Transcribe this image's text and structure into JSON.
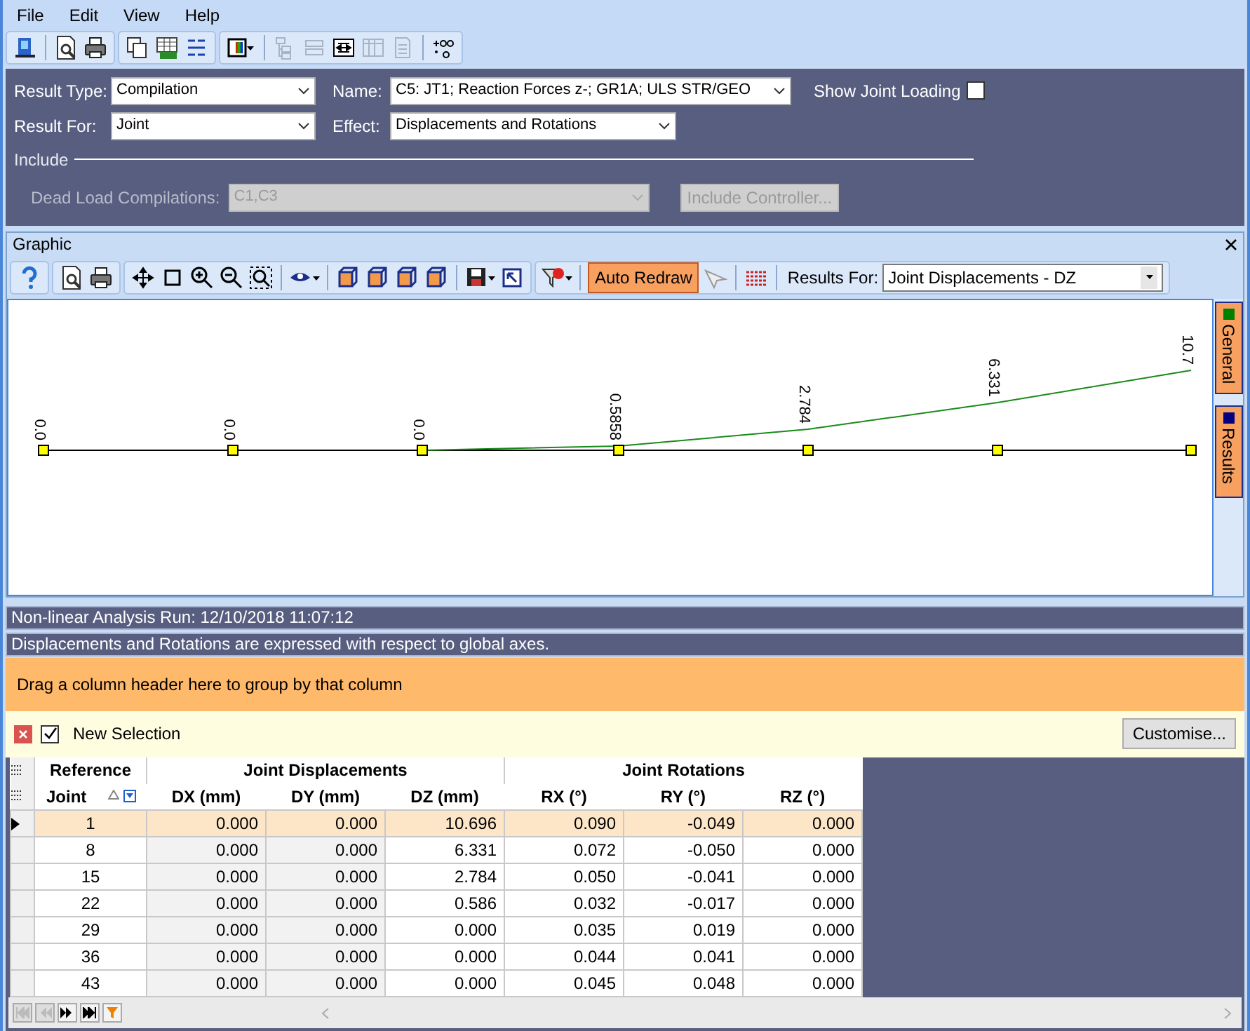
{
  "menu": [
    "File",
    "Edit",
    "View",
    "Help"
  ],
  "form": {
    "result_type": {
      "label": "Result Type:",
      "value": "Compilation"
    },
    "name": {
      "label": "Name:",
      "value": "C5: JT1; Reaction Forces z-; GR1A; ULS STR/GEO"
    },
    "show_joint_loading": {
      "label": "Show Joint Loading",
      "checked": false
    },
    "result_for": {
      "label": "Result For:",
      "value": "Joint"
    },
    "effect": {
      "label": "Effect:",
      "value": "Displacements and Rotations"
    },
    "include": {
      "title": "Include",
      "dead_load": {
        "label": "Dead Load Compilations:",
        "value": "C1,C3",
        "disabled": true
      },
      "controller_button": {
        "label": "Include Controller...",
        "disabled": true
      }
    }
  },
  "graphic": {
    "title": "Graphic",
    "auto_redraw": {
      "label": "Auto Redraw",
      "on": true
    },
    "results_for": {
      "label": "Results For:",
      "value": "Joint Displacements - DZ"
    },
    "joint_labels": [
      "0.0",
      "0.0",
      "0.0",
      "0.5858",
      "2.784",
      "6.331",
      "10.7"
    ],
    "side_tabs": [
      {
        "label": "General",
        "color": "#008000"
      },
      {
        "label": "Results",
        "color": "#000080"
      }
    ]
  },
  "info_lines": [
    "Non-linear Analysis Run: 12/10/2018 11:07:12",
    "Displacements and Rotations are expressed with respect to global axes."
  ],
  "group_hint": "Drag a column header here to group by that column",
  "selection": {
    "label": "New Selection",
    "checked": true
  },
  "customise_button": "Customise...",
  "table": {
    "groups": [
      {
        "label": "Reference",
        "columns": [
          "Joint"
        ]
      },
      {
        "label": "Joint Displacements",
        "columns": [
          "DX (mm)",
          "DY (mm)",
          "DZ (mm)"
        ]
      },
      {
        "label": "Joint Rotations",
        "columns": [
          "RX (°)",
          "RY (°)",
          "RZ (°)"
        ]
      }
    ],
    "rows": [
      {
        "selected": true,
        "cells": [
          "1",
          "0.000",
          "0.000",
          "10.696",
          "0.090",
          "-0.049",
          "0.000"
        ]
      },
      {
        "selected": false,
        "cells": [
          "8",
          "0.000",
          "0.000",
          "6.331",
          "0.072",
          "-0.050",
          "0.000"
        ]
      },
      {
        "selected": false,
        "cells": [
          "15",
          "0.000",
          "0.000",
          "2.784",
          "0.050",
          "-0.041",
          "0.000"
        ]
      },
      {
        "selected": false,
        "cells": [
          "22",
          "0.000",
          "0.000",
          "0.586",
          "0.032",
          "-0.017",
          "0.000"
        ]
      },
      {
        "selected": false,
        "cells": [
          "29",
          "0.000",
          "0.000",
          "0.000",
          "0.035",
          "0.019",
          "0.000"
        ]
      },
      {
        "selected": false,
        "cells": [
          "36",
          "0.000",
          "0.000",
          "0.000",
          "0.044",
          "0.041",
          "0.000"
        ]
      },
      {
        "selected": false,
        "cells": [
          "43",
          "0.000",
          "0.000",
          "0.000",
          "0.045",
          "0.048",
          "0.000"
        ]
      }
    ]
  }
}
